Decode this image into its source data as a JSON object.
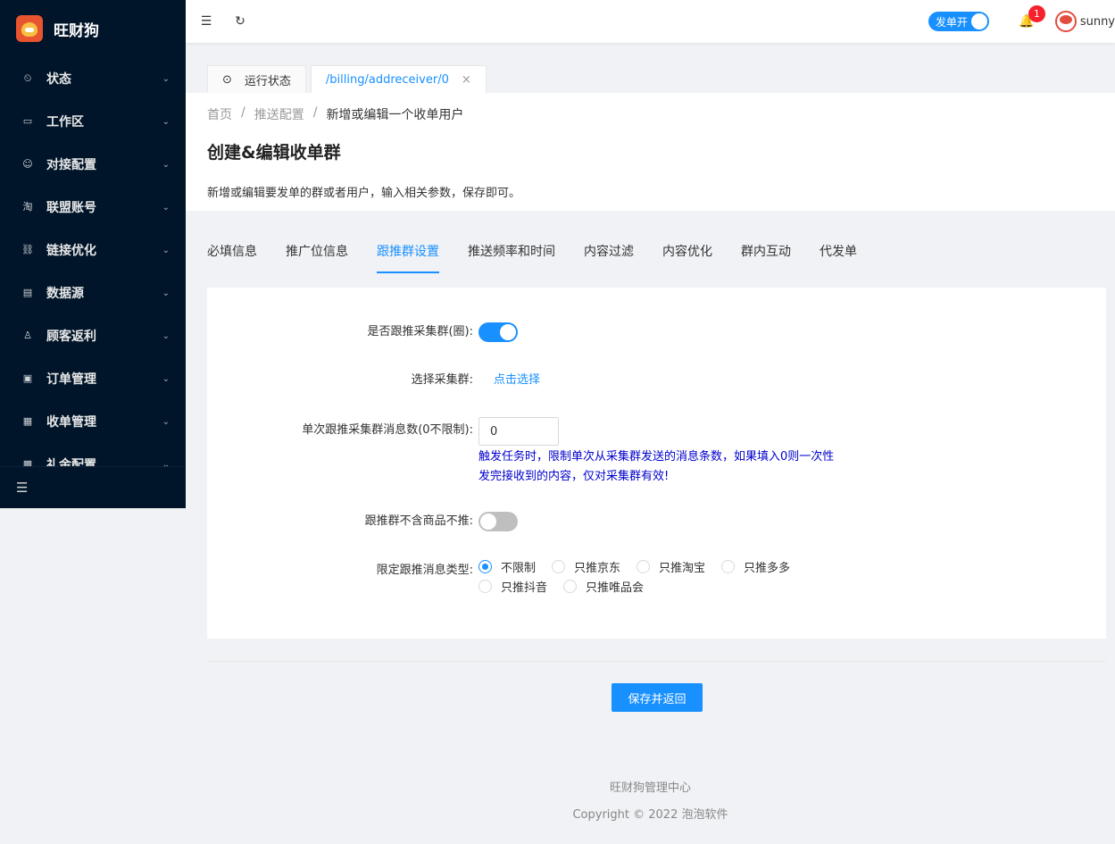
{
  "sidebar": {
    "logo_title": "旺财狗",
    "items": [
      {
        "label": "状态",
        "icon": "⏲"
      },
      {
        "label": "工作区",
        "icon": "▭"
      },
      {
        "label": "对接配置",
        "icon": "☺"
      },
      {
        "label": "联盟账号",
        "icon": "淘"
      },
      {
        "label": "链接优化",
        "icon": "⛓"
      },
      {
        "label": "数据源",
        "icon": "▤"
      },
      {
        "label": "顾客返利",
        "icon": "♙"
      },
      {
        "label": "订单管理",
        "icon": "▣"
      },
      {
        "label": "收单管理",
        "icon": "▦"
      },
      {
        "label": "礼金配置",
        "icon": "▩"
      }
    ],
    "collapse_icon": "☰"
  },
  "header": {
    "menu_icon": "☰",
    "refresh_icon": "↻",
    "send_toggle_label": "发单开",
    "notification_count": "1",
    "bell_icon": "🔔",
    "username": "sunny"
  },
  "page_tabs": [
    {
      "label": "运行状态",
      "icon": "⊙"
    },
    {
      "label": "/billing/addreceiver/0",
      "close": "×"
    }
  ],
  "breadcrumb": {
    "home": "首页",
    "sep": "/",
    "parent": "推送配置",
    "current": "新增或编辑一个收单用户"
  },
  "page": {
    "title": "创建&编辑收单群",
    "description": "新增或编辑要发单的群或者用户，输入相关参数，保存即可。"
  },
  "form_tabs": [
    "必填信息",
    "推广位信息",
    "跟推群设置",
    "推送频率和时间",
    "内容过滤",
    "内容优化",
    "群内互动",
    "代发单"
  ],
  "form": {
    "follow_label": "是否跟推采集群(圈):",
    "follow_on": true,
    "select_label": "选择采集群:",
    "select_link": "点击选择",
    "count_label": "单次跟推采集群消息数(0不限制):",
    "count_value": "0",
    "count_hint": "触发任务时，限制单次从采集群发送的消息条数，如果填入0则一次性发完接收到的内容，仅对采集群有效!",
    "no_goods_label": "跟推群不含商品不推:",
    "no_goods_on": false,
    "type_label": "限定跟推消息类型:",
    "type_options": [
      "不限制",
      "只推京东",
      "只推淘宝",
      "只推多多",
      "只推抖音",
      "只推唯品会"
    ],
    "type_selected": "不限制"
  },
  "save_label": "保存并返回",
  "footer": {
    "line1": "旺财狗管理中心",
    "line2": "Copyright © 2022 泡泡软件"
  },
  "colors": {
    "accent": "#1890ff",
    "sidebar": "#001529",
    "hint": "#0000cc",
    "badge": "#f5222d"
  }
}
